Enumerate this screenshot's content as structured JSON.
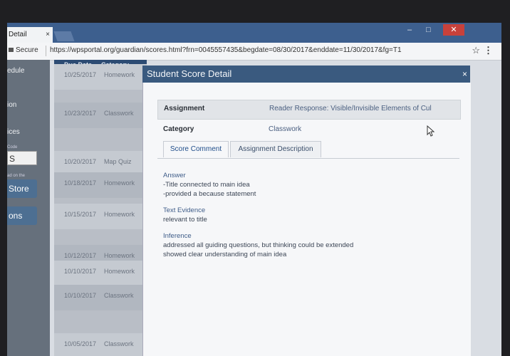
{
  "browser": {
    "tab_title": "Detail",
    "tab_close": "×",
    "window_controls": {
      "minimize": "–",
      "maximize": "□",
      "close": "✕"
    },
    "secure_label": "Secure",
    "url": "https://wpsportal.org/guardian/scores.html?frn=0045557435&begdate=08/30/2017&enddate=11/30/2017&fg=T1",
    "star_icon": "☆",
    "menu_icon": "⋮"
  },
  "sidebar": {
    "items": [
      "edule",
      "ion",
      "ices"
    ],
    "code_caption": "Code",
    "code_value": "S",
    "store_caption": "ad on the",
    "store_button": "Store",
    "dimmed_button": "ons"
  },
  "table": {
    "headers": [
      "Due Date",
      "Category"
    ],
    "rows": [
      {
        "date": "10/25/2017",
        "category": "Homework"
      },
      {
        "date": "10/23/2017",
        "category": "Classwork"
      },
      {
        "date": "10/20/2017",
        "category": "Map Quiz"
      },
      {
        "date": "10/18/2017",
        "category": "Homework"
      },
      {
        "date": "10/15/2017",
        "category": "Homework"
      },
      {
        "date": "10/12/2017",
        "category": "Homework"
      },
      {
        "date": "10/10/2017",
        "category": "Homework"
      },
      {
        "date": "10/10/2017",
        "category": "Classwork"
      },
      {
        "date": "10/05/2017",
        "category": "Classwork"
      }
    ]
  },
  "modal": {
    "title": "Student Score Detail",
    "close": "×",
    "assignment_label": "Assignment",
    "assignment_value": "Reader Response: Visible/Invisible Elements of Cul",
    "category_label": "Category",
    "category_value": "Classwork",
    "tabs": [
      "Score Comment",
      "Assignment Description"
    ],
    "comment": {
      "answer_heading": "Answer",
      "answer_lines": [
        "-Title connected to main idea",
        "-provided a because statement"
      ],
      "evidence_heading": "Text Evidence",
      "evidence_lines": [
        "relevant to title"
      ],
      "inference_heading": "Inference",
      "inference_lines": [
        "addressed all guiding questions, but thinking could be extended",
        "showed clear understanding of main idea"
      ]
    }
  }
}
